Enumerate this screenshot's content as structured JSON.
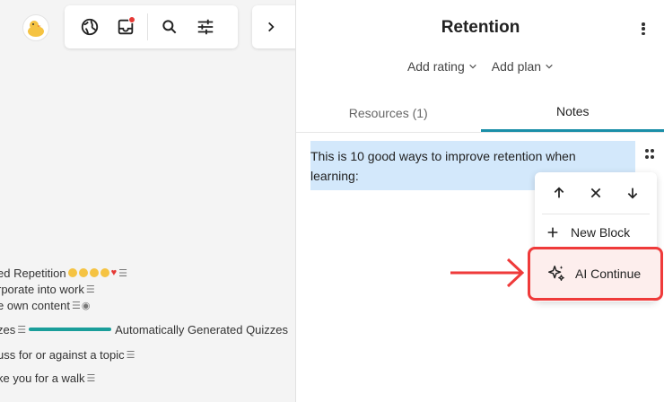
{
  "canvas": {
    "list_items": [
      {
        "text": "ed Repetition"
      },
      {
        "text": "rporate into work"
      },
      {
        "text": "e own content"
      },
      {
        "text_before": "zes",
        "text_after": "Automatically Generated Quizzes"
      },
      {
        "text": "uss for or against a topic"
      },
      {
        "text": "ke you for a walk"
      }
    ]
  },
  "panel": {
    "title": "Retention",
    "actions": {
      "add_rating": "Add rating",
      "add_plan": "Add plan"
    },
    "tabs": [
      {
        "label": "Resources (1)",
        "active": false
      },
      {
        "label": "Notes",
        "active": true
      }
    ],
    "note": {
      "text": "This is 10 good ways to improve retention when learning:"
    },
    "block_menu": {
      "new_block": "New Block",
      "ai_continue": "AI Continue"
    }
  },
  "colors": {
    "accent": "#1a8fa8",
    "highlight_red": "#ef3a3a",
    "selection_blue": "#d3e8fb"
  }
}
